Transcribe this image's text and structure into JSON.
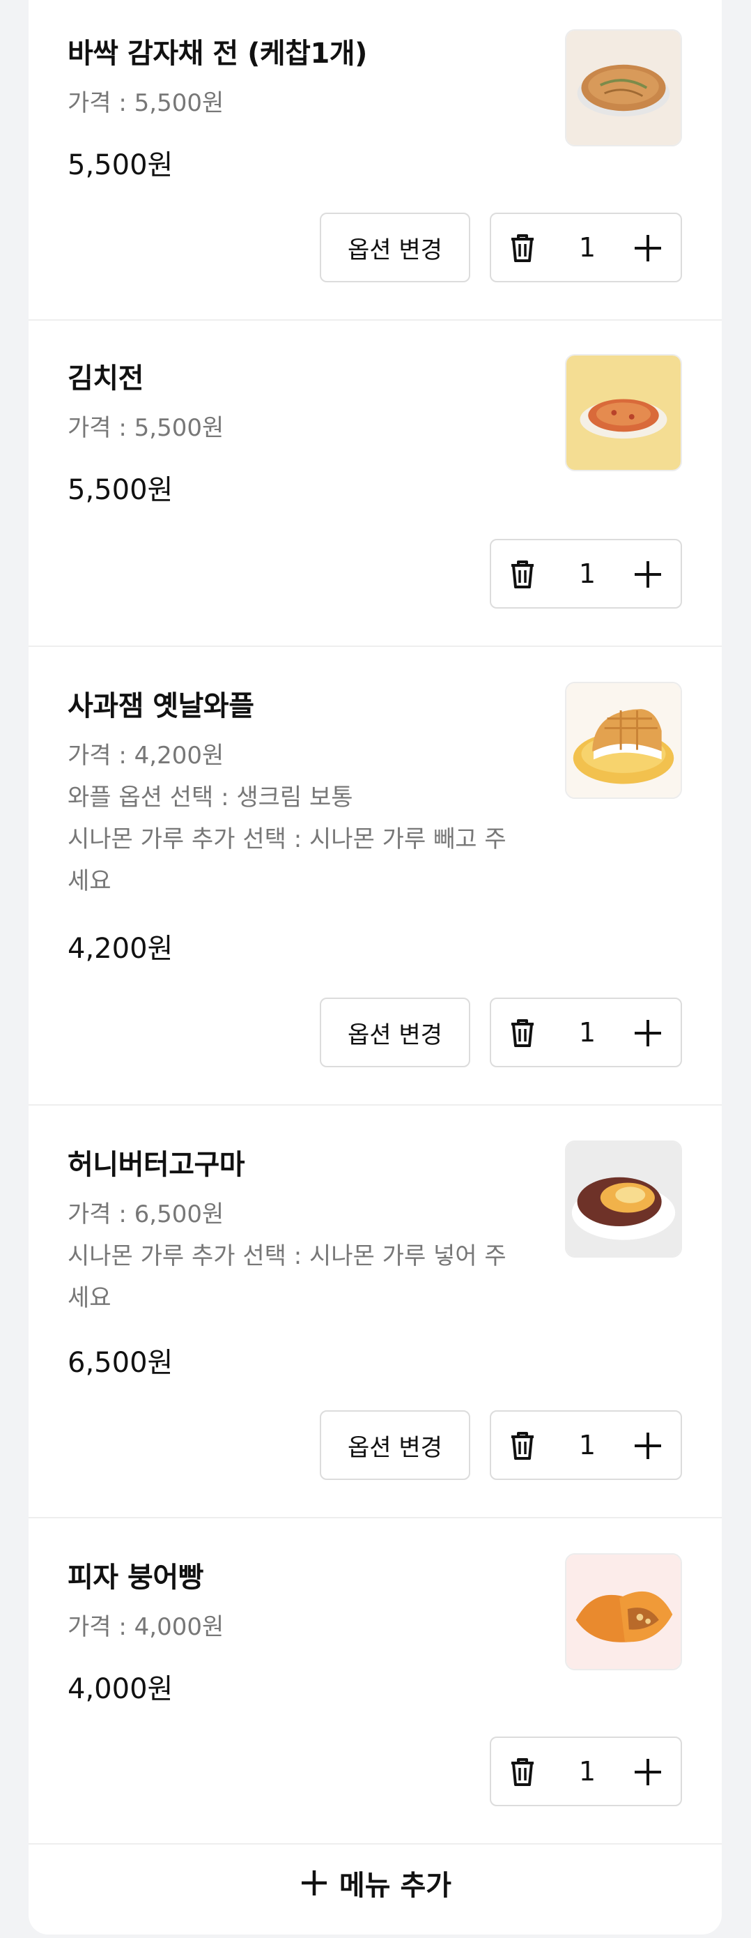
{
  "items": [
    {
      "name": "바싹 감자채 전 (케찹1개)",
      "price_label": "가격 : 5,500원",
      "options": [],
      "total": "5,500원",
      "has_option_button": true,
      "quantity": "1",
      "thumb_icon": "potato-pancake-image"
    },
    {
      "name": "김치전",
      "price_label": "가격 : 5,500원",
      "options": [],
      "total": "5,500원",
      "has_option_button": false,
      "quantity": "1",
      "thumb_icon": "kimchi-pancake-image"
    },
    {
      "name": "사과잼 옛날와플",
      "price_label": "가격 : 4,200원",
      "options": [
        "와플 옵션 선택 : 생크림 보통",
        "시나몬 가루 추가 선택 : 시나몬 가루 빼고 주",
        "세요"
      ],
      "total": "4,200원",
      "has_option_button": true,
      "quantity": "1",
      "thumb_icon": "waffle-image"
    },
    {
      "name": "허니버터고구마",
      "price_label": "가격 : 6,500원",
      "options": [
        "시나몬 가루 추가 선택 : 시나몬 가루 넣어 주",
        "세요"
      ],
      "total": "6,500원",
      "has_option_button": true,
      "quantity": "1",
      "thumb_icon": "sweet-potato-image"
    },
    {
      "name": "피자 붕어빵",
      "price_label": "가격 : 4,000원",
      "options": [],
      "total": "4,000원",
      "has_option_button": false,
      "quantity": "1",
      "thumb_icon": "fish-bread-image"
    }
  ],
  "option_button_label": "옵션 변경",
  "add_menu_label": "메뉴 추가",
  "icons": {
    "delete": "trash-icon",
    "increase": "plus-icon",
    "add": "plus-icon"
  }
}
